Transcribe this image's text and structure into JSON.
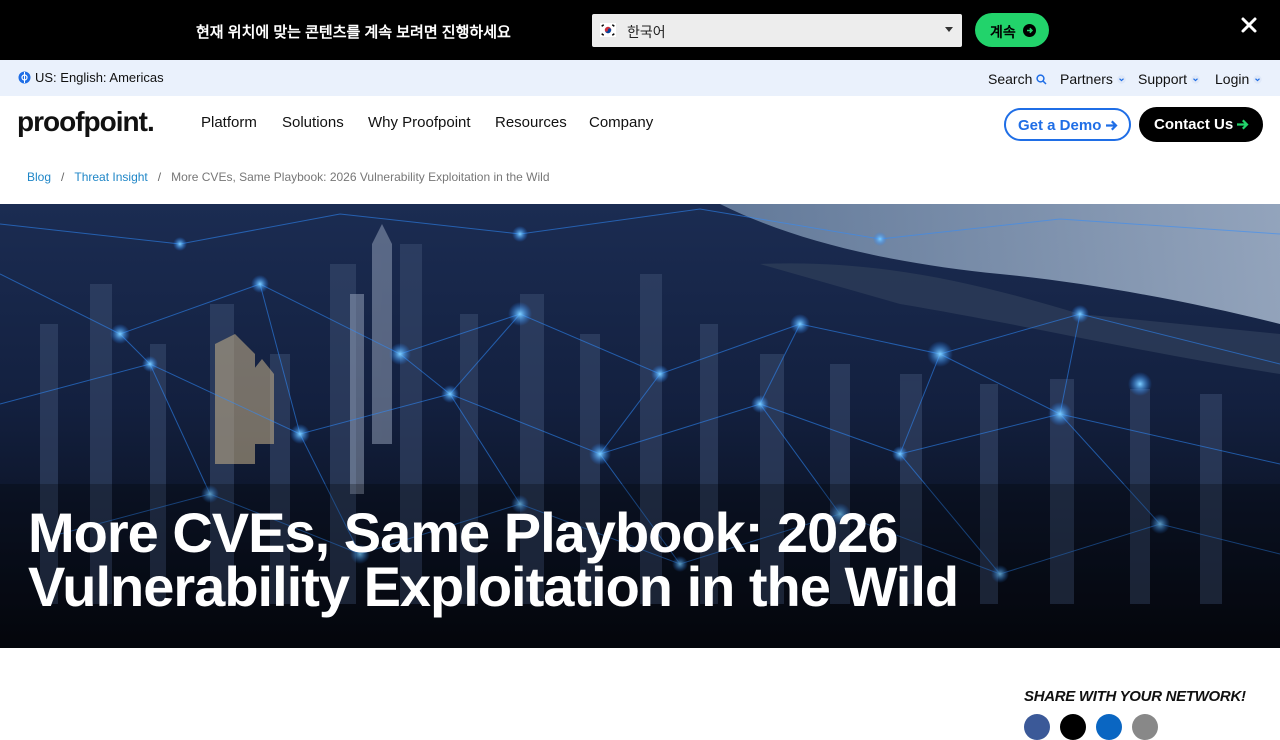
{
  "geo_banner": {
    "message": "현재 위치에 맞는 콘텐츠를 계속 보려면 진행하세요",
    "language_selected": "한국어",
    "continue_label": "계속"
  },
  "utility_bar": {
    "region": "US: English: Americas",
    "links": [
      "Search",
      "Partners",
      "Support",
      "Login"
    ]
  },
  "nav": {
    "logo": "proofpoint.",
    "items": [
      "Platform",
      "Solutions",
      "Why Proofpoint",
      "Resources",
      "Company"
    ],
    "demo_label": "Get a Demo",
    "contact_label": "Contact Us"
  },
  "breadcrumb": {
    "items": [
      "Blog",
      "Threat Insight"
    ],
    "current": "More CVEs, Same Playbook: 2026 Vulnerability Exploitation in the Wild"
  },
  "hero": {
    "title": "More CVEs, Same Playbook: 2026 Vulnerability Exploitation in the Wild"
  },
  "share": {
    "title": "SHARE WITH YOUR NETWORK!"
  },
  "colors": {
    "banner_bg": "#000000",
    "continue_green": "#22d36b",
    "utility_bg": "#eaf1fc",
    "link_blue": "#1f6ee6",
    "crumb_blue": "#1f86c7"
  }
}
